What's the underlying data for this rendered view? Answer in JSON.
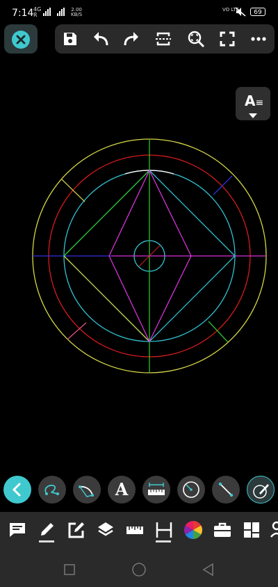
{
  "status_bar": {
    "time": "7:14",
    "network": "4G",
    "network_alt": "R",
    "speed_value": "2.00",
    "speed_unit": "KB/S",
    "volte": "VO LTE",
    "battery": "69"
  },
  "top_toolbar": {
    "buttons": [
      "close-icon",
      "save-icon",
      "undo-icon",
      "redo-icon",
      "section-icon",
      "zoom-icon",
      "fullscreen-icon",
      "more-icon"
    ]
  },
  "text_style_button": {
    "label": "A"
  },
  "drawing": {
    "layer_colors": {
      "outer": "#e6e64d",
      "red": "#e01919",
      "cyan": "#33c8d8",
      "magenta": "#d633d6",
      "green": "#2fbf2f",
      "blue": "#2b2bd6",
      "white": "#ffffff"
    },
    "outer_circle_label": "",
    "shapes": [
      "outer-circle",
      "red-circle",
      "cyan-circle",
      "center-circle",
      "rhombus",
      "square",
      "axes"
    ]
  },
  "tool_row": {
    "buttons": [
      "back-icon",
      "curve-icon",
      "arc-icon",
      "text-tool",
      "measure-icon",
      "circle-icon",
      "line-icon",
      "brush-icon"
    ],
    "text_tool_label": "A"
  },
  "bottom_bar": {
    "buttons": [
      "comment-icon",
      "pencil-icon",
      "edit-icon",
      "layers-icon",
      "ruler-icon",
      "dimension-icon",
      "color-icon",
      "toolbox-icon",
      "grid-icon",
      "more-icon"
    ]
  },
  "accent_color": "#3fc9cf"
}
